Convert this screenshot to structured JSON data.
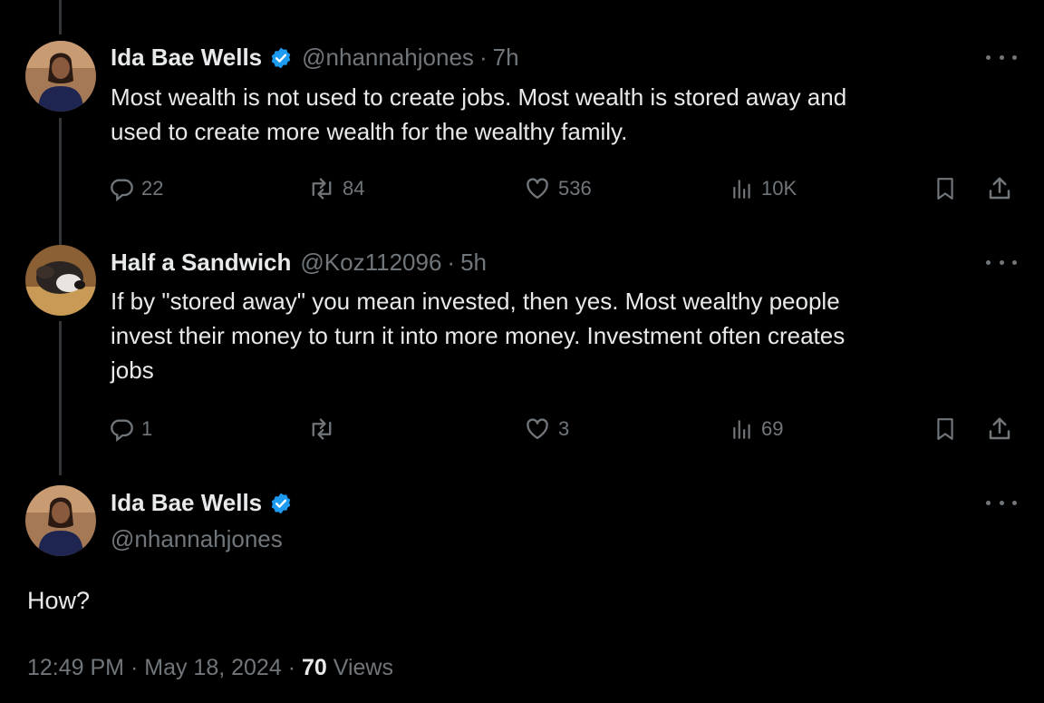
{
  "tweets": [
    {
      "name": "Ida Bae Wells",
      "handle": "@nhannahjones",
      "time": "7h",
      "text": "Most wealth is not used to create jobs. Most wealth is stored away and\nused to create more wealth for the wealthy family.",
      "replies": "22",
      "reposts": "84",
      "likes": "536",
      "views": "10K",
      "verified": true
    },
    {
      "name": "Half a Sandwich",
      "handle": "@Koz112096",
      "time": "5h",
      "text": "If by \"stored away\" you mean invested, then yes. Most wealthy people\ninvest their money to turn it into more money. Investment often creates\njobs",
      "replies": "1",
      "reposts": "",
      "likes": "3",
      "views": "69",
      "verified": false
    }
  ],
  "focal": {
    "name": "Ida Bae Wells",
    "handle": "@nhannahjones",
    "text": "How?",
    "time": "12:49 PM",
    "date": "May 18, 2024",
    "views_count": "70",
    "views_label": "Views"
  },
  "separator": "·",
  "colors": {
    "background": "#000000",
    "text": "#e7e9ea",
    "muted": "#71767b",
    "verified": "#1d9bf0"
  },
  "icons": [
    "reply-icon",
    "repost-icon",
    "like-icon",
    "views-icon",
    "bookmark-icon",
    "share-icon",
    "verified-badge-icon",
    "more-icon"
  ]
}
